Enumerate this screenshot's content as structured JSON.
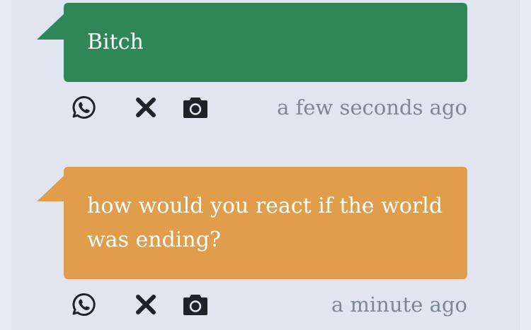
{
  "messages": [
    {
      "text": "Bitch",
      "color": "#2f8659",
      "timestamp": "a few seconds ago",
      "icons": [
        "whatsapp-icon",
        "close-icon",
        "camera-icon"
      ]
    },
    {
      "text": "how would you react if the world was ending?",
      "color": "#e09d4b",
      "timestamp": "a minute ago",
      "icons": [
        "whatsapp-icon",
        "close-icon",
        "camera-icon"
      ]
    }
  ]
}
